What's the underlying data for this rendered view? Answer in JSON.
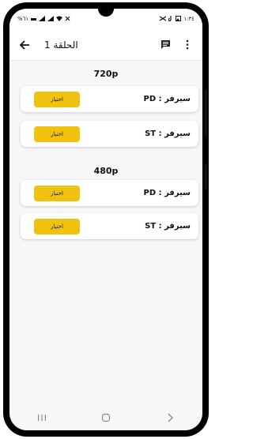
{
  "status_bar": {
    "left_text": "%٦١",
    "left_icons": [
      "vowifi-icon",
      "signal-icon",
      "signal-icon",
      "wifi-icon",
      "mute-icon"
    ],
    "time": "١:٣٤",
    "right_icons": [
      "image-icon",
      "tiktok-icon",
      "capcut-icon"
    ]
  },
  "app_bar": {
    "title": "الحلقة 1",
    "icons": [
      "back-arrow-icon",
      "comment-icon",
      "more-vert-icon"
    ]
  },
  "sections": [
    {
      "title": "720p",
      "servers": [
        {
          "label": "سيرفر : PD",
          "button": "اختيار"
        },
        {
          "label": "سيرفر : ST",
          "button": "اختيار"
        }
      ]
    },
    {
      "title": "480p",
      "servers": [
        {
          "label": "سيرفر : PD",
          "button": "اختيار"
        },
        {
          "label": "سيرفر : ST",
          "button": "اختيار"
        }
      ]
    }
  ],
  "nav_bar": {
    "icons": [
      "recent-apps-icon",
      "home-icon",
      "back-nav-icon"
    ]
  },
  "colors": {
    "accent_button": "#efc20f",
    "background": "#f7f7f7",
    "card": "#ffffff"
  }
}
